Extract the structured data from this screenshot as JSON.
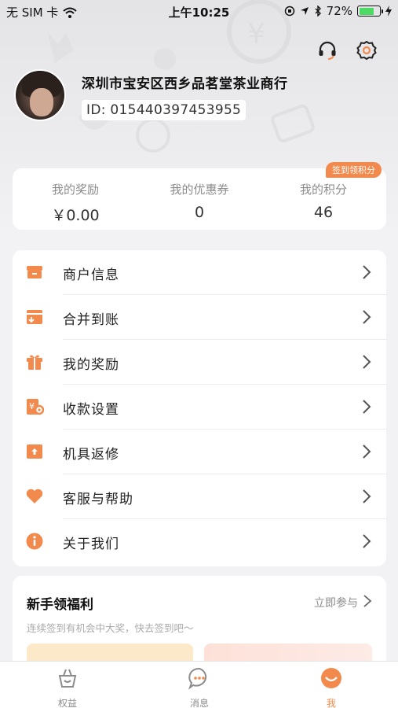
{
  "status_bar": {
    "carrier": "无 SIM 卡",
    "time": "上午10:25",
    "battery_percent": "72%",
    "battery_level": 0.72
  },
  "profile": {
    "shop_name": "深圳市宝安区西乡品茗堂茶业商行",
    "shop_id": "ID: 015440397453955"
  },
  "stats": {
    "badge": "签到领积分",
    "items": [
      {
        "label": "我的奖励",
        "value": "￥0.00"
      },
      {
        "label": "我的优惠券",
        "value": "0"
      },
      {
        "label": "我的积分",
        "value": "46"
      }
    ]
  },
  "menu": {
    "items": [
      {
        "label": "商户信息",
        "icon": "store-icon"
      },
      {
        "label": "合并到账",
        "icon": "merge-account-icon"
      },
      {
        "label": "我的奖励",
        "icon": "gift-icon"
      },
      {
        "label": "收款设置",
        "icon": "payment-settings-icon"
      },
      {
        "label": "机具返修",
        "icon": "device-repair-icon"
      },
      {
        "label": "客服与帮助",
        "icon": "heart-icon"
      },
      {
        "label": "关于我们",
        "icon": "info-icon"
      }
    ]
  },
  "welfare": {
    "title": "新手领福利",
    "join": "立即参与",
    "subtitle": "连续签到有机会中大奖，快去签到吧～"
  },
  "tabs": [
    {
      "label": "权益",
      "icon": "basket-icon",
      "active": false
    },
    {
      "label": "消息",
      "icon": "message-icon",
      "active": false
    },
    {
      "label": "我",
      "icon": "smile-face-icon",
      "active": true
    }
  ],
  "colors": {
    "accent": "#f28a4d",
    "tab_active": "#f28a4d",
    "tab_inactive": "#8c8c8c"
  }
}
